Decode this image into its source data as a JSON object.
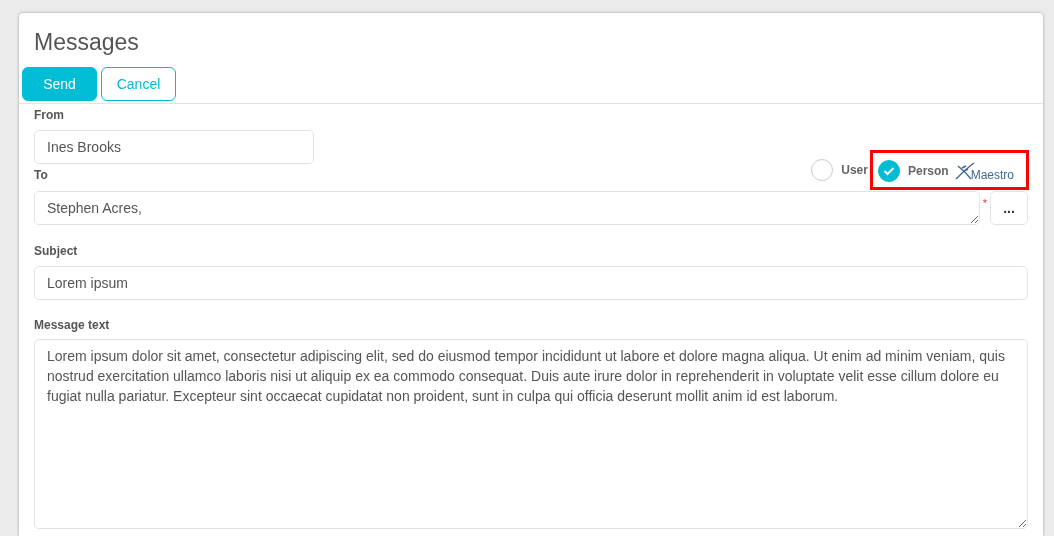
{
  "title": "Messages",
  "buttons": [
    {
      "label": "Send",
      "kind": "primary"
    },
    {
      "label": "Cancel",
      "kind": "outline"
    }
  ],
  "from": {
    "label": "From",
    "value": "Ines Brooks"
  },
  "recipient_type": {
    "options": [
      {
        "label": "User",
        "selected": false,
        "highlighted": false
      },
      {
        "label": "Person",
        "selected": true,
        "highlighted": true
      }
    ],
    "logo": "Maestro"
  },
  "to": {
    "label": "To",
    "value": "Stephen Acres,",
    "required_mark": "*",
    "picker_button": "..."
  },
  "subject": {
    "label": "Subject",
    "value": "Lorem ipsum"
  },
  "message": {
    "label": "Message text",
    "value": "Lorem ipsum dolor sit amet, consectetur adipiscing elit, sed do eiusmod tempor incididunt ut labore et dolore magna aliqua. Ut enim ad minim veniam, quis nostrud exercitation ullamco laboris nisi ut aliquip ex ea commodo consequat. Duis aute irure dolor in reprehenderit in voluptate velit esse cillum dolore eu fugiat nulla pariatur. Excepteur sint occaecat cupidatat non proident, sunt in culpa qui officia deserunt mollit anim id est laborum."
  }
}
